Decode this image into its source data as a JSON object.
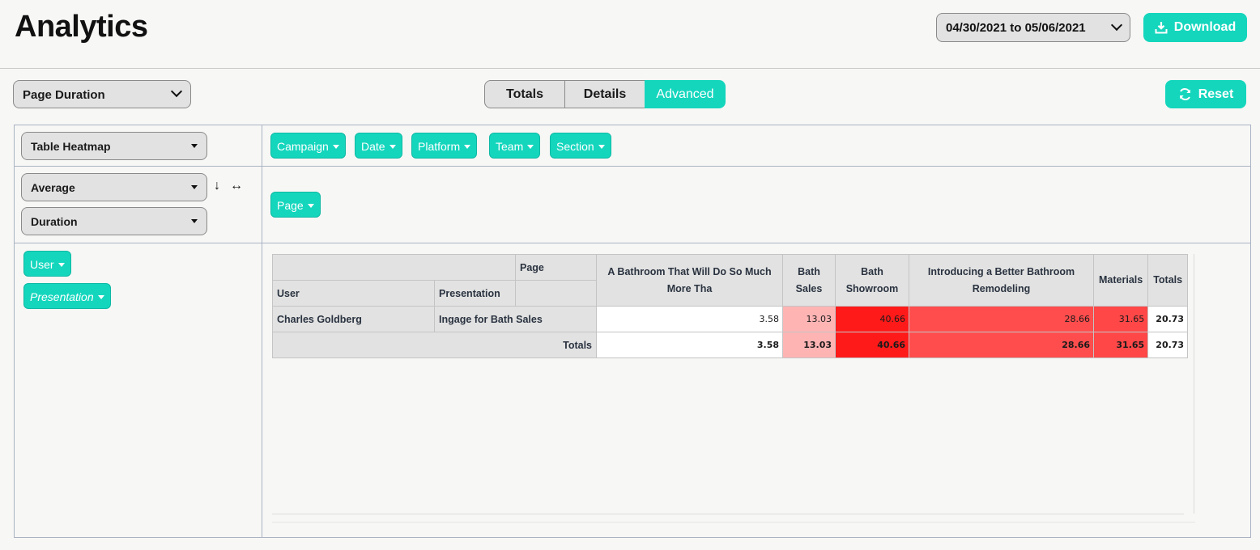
{
  "header": {
    "title": "Analytics",
    "date_range": "04/30/2021 to 05/06/2021",
    "download_label": "Download"
  },
  "toolbar": {
    "metric": "Page Duration",
    "tabs": [
      {
        "label": "Totals",
        "active": false
      },
      {
        "label": "Details",
        "active": false
      },
      {
        "label": "Advanced",
        "active": true
      }
    ],
    "reset_label": "Reset"
  },
  "pivot": {
    "renderer": "Table Heatmap",
    "aggregator": "Average",
    "aggregator_field": "Duration",
    "sort_row_symbol": "↓",
    "sort_col_symbol": "↔",
    "unused_attributes": [
      "Campaign",
      "Date",
      "Platform",
      "Team",
      "Section"
    ],
    "column_attributes": [
      "Page"
    ],
    "row_attributes": [
      {
        "label": "User",
        "italic": false
      },
      {
        "label": "Presentation",
        "italic": true
      }
    ],
    "table": {
      "col_attr_label": "Page",
      "row_headers": [
        "User",
        "Presentation"
      ],
      "columns": [
        "A Bathroom That Will Do So Much More Tha",
        "Bath Sales",
        "Bath Showroom",
        "Introducing a Better Bathroom Remodeling",
        "Materials"
      ],
      "totals_label": "Totals",
      "rows": [
        {
          "user": "Charles Goldberg",
          "presentation": "Ingage for Bath Sales",
          "values": [
            "3.58",
            "13.03",
            "40.66",
            "28.66",
            "31.65"
          ],
          "total": "20.73"
        }
      ],
      "col_totals": [
        "3.58",
        "13.03",
        "40.66",
        "28.66",
        "31.65"
      ],
      "grand_total": "20.73",
      "heat_colors": [
        "#ffffff",
        "#ffb4b4",
        "#ff1a1a",
        "#ff4d4d",
        "#ff4747"
      ]
    }
  },
  "colors": {
    "accent": "#14d6bd",
    "background": "#f7f7f5"
  }
}
